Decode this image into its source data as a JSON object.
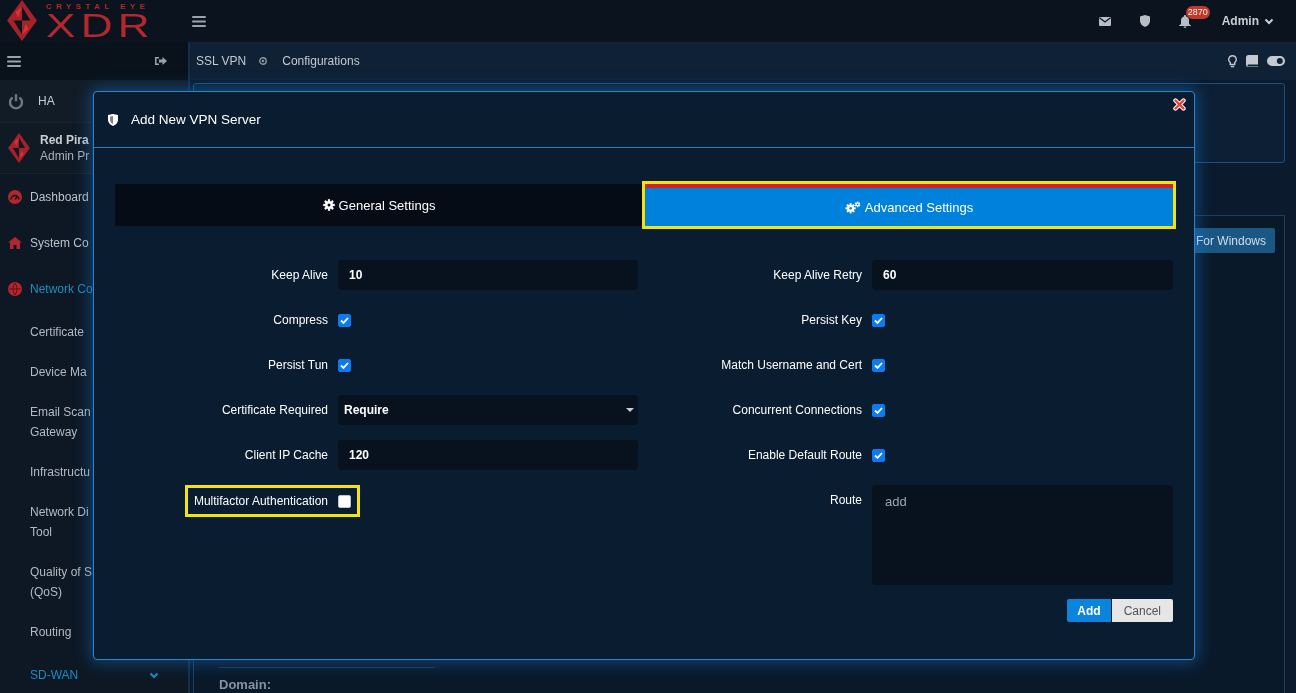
{
  "header": {
    "logo": {
      "tagline": "CRYSTAL EYE",
      "wordmark": "XDR"
    },
    "notification_count": "2870",
    "user": "Admin"
  },
  "sidebar": {
    "ha": {
      "label": "HA"
    },
    "profile": {
      "name": "Red Pira",
      "role": "Admin Pr"
    },
    "items": [
      {
        "label": "Dashboard",
        "kind": "link",
        "active": false
      },
      {
        "label": "System Co",
        "kind": "link",
        "active": false
      },
      {
        "label": "Network Co",
        "kind": "link",
        "active": true,
        "children": [
          {
            "label": "Certificate"
          },
          {
            "label": "Device Ma"
          },
          {
            "label": "Email Scan\nGateway"
          },
          {
            "label": "Infrastructu"
          },
          {
            "label": "Network Di\nTool"
          },
          {
            "label": "Quality of S\n(QoS)"
          },
          {
            "label": "Routing"
          }
        ]
      },
      {
        "label": "SD-WAN",
        "kind": "submenu",
        "active": true
      }
    ]
  },
  "breadcrumb": [
    {
      "label": "SSL VPN"
    },
    {
      "label": "Configurations"
    }
  ],
  "servers_panel": {
    "download_button": "For Windows",
    "domain_label": "Domain:"
  },
  "modal": {
    "title": "Add New VPN Server",
    "tabs": [
      {
        "label": "General Settings",
        "selected": false,
        "highlighted": false
      },
      {
        "label": "Advanced Settings",
        "selected": true,
        "highlighted": true
      }
    ],
    "left_fields": [
      {
        "label": "Keep Alive",
        "kind": "text",
        "value": "10",
        "highlighted": false
      },
      {
        "label": "Compress",
        "kind": "checkbox",
        "checked": true,
        "highlighted": false
      },
      {
        "label": "Persist Tun",
        "kind": "checkbox",
        "checked": true,
        "highlighted": false
      },
      {
        "label": "Certificate Required",
        "kind": "select",
        "value": "Require",
        "highlighted": false
      },
      {
        "label": "Client IP Cache",
        "kind": "text",
        "value": "120",
        "highlighted": false
      },
      {
        "label": "Multifactor Authentication",
        "kind": "checkbox",
        "checked": false,
        "highlighted": true
      }
    ],
    "right_fields": [
      {
        "label": "Keep Alive Retry",
        "kind": "text",
        "value": "60",
        "highlighted": false
      },
      {
        "label": "Persist Key",
        "kind": "checkbox",
        "checked": true,
        "highlighted": false
      },
      {
        "label": "Match Username and Cert",
        "kind": "checkbox",
        "checked": true,
        "highlighted": false
      },
      {
        "label": "Concurrent Connections",
        "kind": "checkbox",
        "checked": true,
        "highlighted": false
      },
      {
        "label": "Enable Default Route",
        "kind": "checkbox",
        "checked": true,
        "highlighted": false
      },
      {
        "label": "Route",
        "kind": "textarea",
        "placeholder": "add",
        "highlighted": false
      }
    ],
    "buttons": [
      {
        "label": "Add",
        "kind": "primary"
      },
      {
        "label": "Cancel",
        "kind": "secondary"
      }
    ]
  }
}
